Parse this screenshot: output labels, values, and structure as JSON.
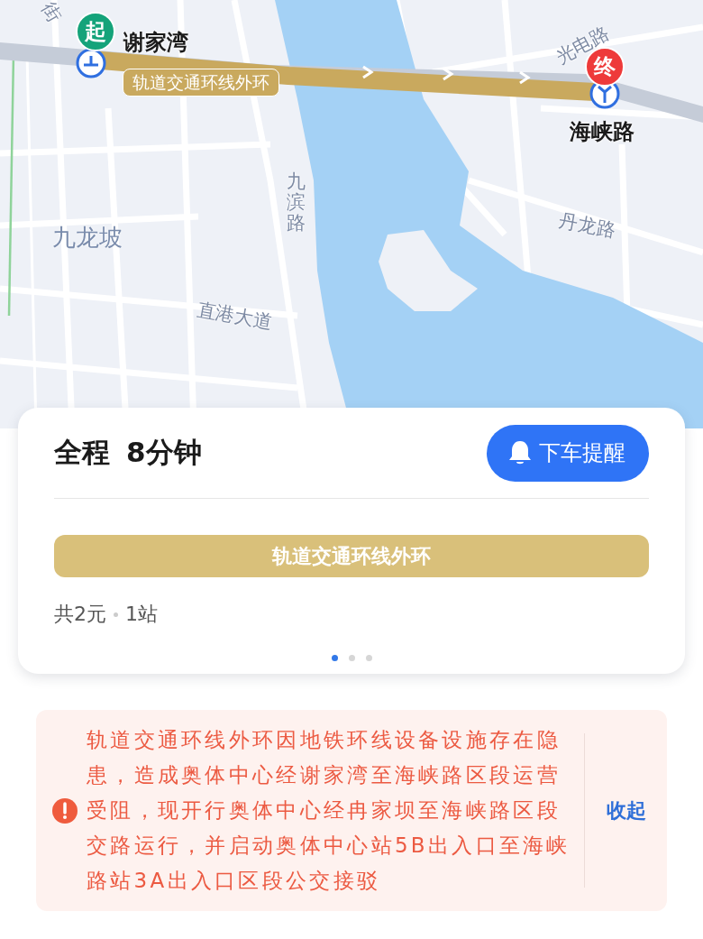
{
  "map": {
    "road_labels": [
      {
        "text": "街",
        "kind": "diagonal"
      },
      {
        "text": "光电路",
        "kind": "tilted"
      },
      {
        "text": "九滨路",
        "kind": "vertical"
      },
      {
        "text": "丹龙路",
        "kind": "slanted"
      },
      {
        "text": "直港大道",
        "kind": "slanted"
      }
    ],
    "district_labels": [
      {
        "text": "九龙坡"
      }
    ],
    "route": {
      "label": "轨道交通环线外环",
      "color": "#c9a95e"
    },
    "start": {
      "marker": "起",
      "station": "谢家湾",
      "color": "#14a37a"
    },
    "end": {
      "marker": "终",
      "station": "海峡路",
      "color": "#ee3a3a"
    }
  },
  "summary": {
    "label": "全程",
    "duration": "8分钟",
    "reminder_button": "下车提醒",
    "line": {
      "name": "轨道交通环线外环",
      "color": "#d9c07a"
    },
    "fare": "共2元",
    "stops": "1站",
    "pages": [
      {
        "selected": true
      },
      {
        "selected": false
      },
      {
        "selected": false
      }
    ]
  },
  "notice": {
    "text": "轨道交通环线外环因地铁环线设备设施存在隐患，造成奥体中心经谢家湾至海峡路区段运营受阻，现开行奥体中心经冉家坝至海峡路区段交路运行，并启动奥体中心站5B出入口至海峡路站3A出入口区段公交接驳",
    "collapse": "收起"
  }
}
